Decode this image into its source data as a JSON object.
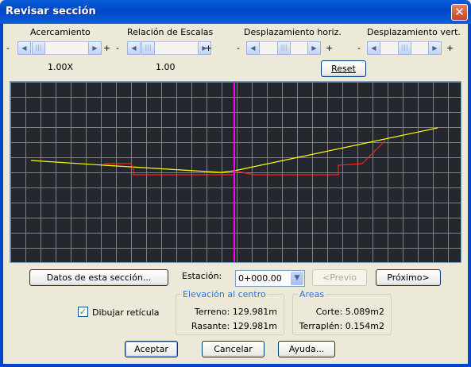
{
  "window": {
    "title": "Revisar sección",
    "close_glyph": "✕"
  },
  "controls": {
    "zoom": {
      "label": "Acercamiento",
      "value": "1.00X"
    },
    "scale": {
      "label": "Relación de Escalas",
      "value": "1.00"
    },
    "hshift": {
      "label": "Desplazamiento horiz."
    },
    "vshift": {
      "label": "Desplazamiento vert."
    },
    "minus": "-",
    "plus": "+",
    "reset_label": "Reset"
  },
  "section_view": {
    "background": "#24272e",
    "grid_color": "#808080",
    "centerline_color": "#ff00ff",
    "terrain_color": "#ffff00",
    "design_color": "#ff2020"
  },
  "actions": {
    "datos_label": "Datos de esta sección...",
    "estacion_label": "Estación:",
    "estacion_value": "0+000.00",
    "previo_label": "<Previo",
    "proximo_label": "Próximo>"
  },
  "grid_checkbox": {
    "label": "Dibujar retícula",
    "checked_glyph": "✓"
  },
  "elevacion": {
    "title": "Elevación al centro",
    "terreno": "Terreno: 129.981m",
    "rasante": "Rasante: 129.981m"
  },
  "areas": {
    "title": "Areas",
    "corte": "Corte: 5.089m2",
    "terraplen": "Terraplén: 0.154m2"
  },
  "footer": {
    "accept_label": "Aceptar",
    "cancel_label": "Cancelar",
    "help_label": "Ayuda..."
  }
}
